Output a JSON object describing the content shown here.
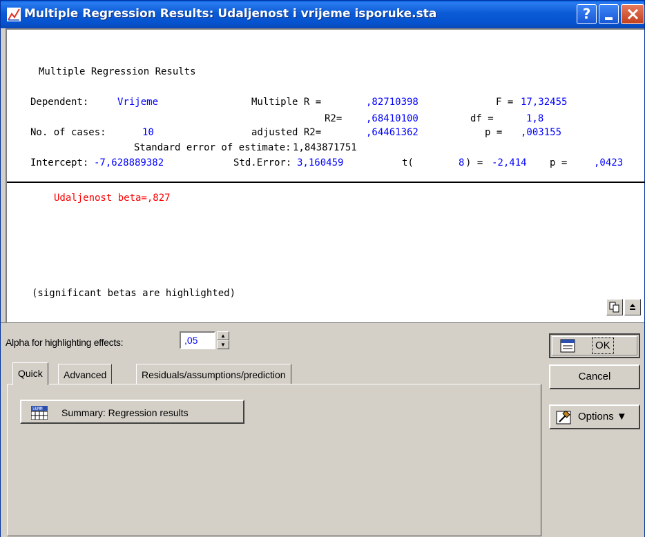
{
  "window": {
    "title": "Multiple Regression Results: Udaljenost i vrijeme isporuke.sta",
    "buttons": {
      "help": "?",
      "minimize": "",
      "close": ""
    }
  },
  "output": {
    "heading": "Multiple Regression Results",
    "dependent_label": "Dependent:",
    "dependent_value": "Vrijeme",
    "multiple_r_label": "Multiple R =",
    "multiple_r_value": ",82710398",
    "f_label": "F =",
    "f_value": "17,32455",
    "r2_label": "R2=",
    "r2_value": ",68410100",
    "df_label": "df =",
    "df_value": "1,8",
    "cases_label": "No. of cases:",
    "cases_value": "10",
    "adj_r2_label": "adjusted R2=",
    "adj_r2_value": ",64461362",
    "p_label": "p =",
    "p_value": ",003155",
    "se_label": "Standard error of estimate:",
    "se_value": "1,843871751",
    "intercept_label": "Intercept:",
    "intercept_value": "-7,628889382",
    "stderr_label": "Std.Error:",
    "stderr_value": "3,160459",
    "t_label": "t(",
    "t_df": "8",
    "t_eq": ") =",
    "t_value": "-2,414",
    "p2_label": "p =",
    "p2_value": ",0423",
    "beta_line": "Udaljenost beta=,827",
    "note": "(significant betas are highlighted)"
  },
  "controls": {
    "alpha_label": "Alpha for highlighting effects:",
    "alpha_value": ",05",
    "tabs": [
      {
        "label": "Quick",
        "active": true
      },
      {
        "label": "Advanced",
        "active": false
      },
      {
        "label": "Residuals/assumptions/prediction",
        "active": false
      }
    ],
    "summary_button": "Summary:  Regression results",
    "ok_button": "OK",
    "cancel_button": "Cancel",
    "options_button": "Options ▼"
  },
  "icons": [
    "statistica-icon",
    "copy-icon",
    "scroll-up-icon",
    "summary-table-icon",
    "ok-sheet-icon",
    "options-hammer-icon"
  ],
  "colors": {
    "value_blue": "#0000ff",
    "highlight_red": "#ff0000",
    "title_blue": "#0553cf"
  }
}
